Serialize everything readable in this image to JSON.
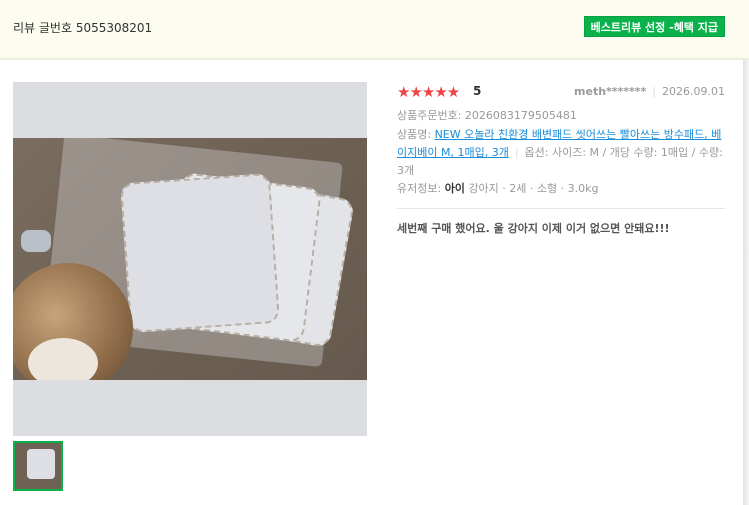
{
  "header": {
    "review_number": "리뷰 글번호 5055308201",
    "best_badge": "베스트리뷰 선정 -혜택 지급"
  },
  "review": {
    "stars": "★★★★★",
    "rating": "5",
    "author": "meth*******",
    "date": "2026.09.01",
    "order_number": "상품주문번호: 2026083179505481",
    "product_label": "상품명: ",
    "product_name": "NEW 오놀라 친환경 배변패드 씻어쓰는 빨아쓰는 방수패드, 베이지베이 M, 1매입, 3개",
    "options": "옵션: 사이즈: M / 개당 수량: 1매입 / 수량: 3개",
    "pet_label": "유저정보: ",
    "pet_name": "아이",
    "pet_details": "강아지 · 2세 · 소형 · 3.0kg",
    "text": "세번째 구매 했어요. 울 강아지 이제 이거 없으면 안돼요!!!"
  },
  "colors": {
    "star": "#f04548",
    "badge": "#0bb24c",
    "link": "#1a8cd8"
  }
}
